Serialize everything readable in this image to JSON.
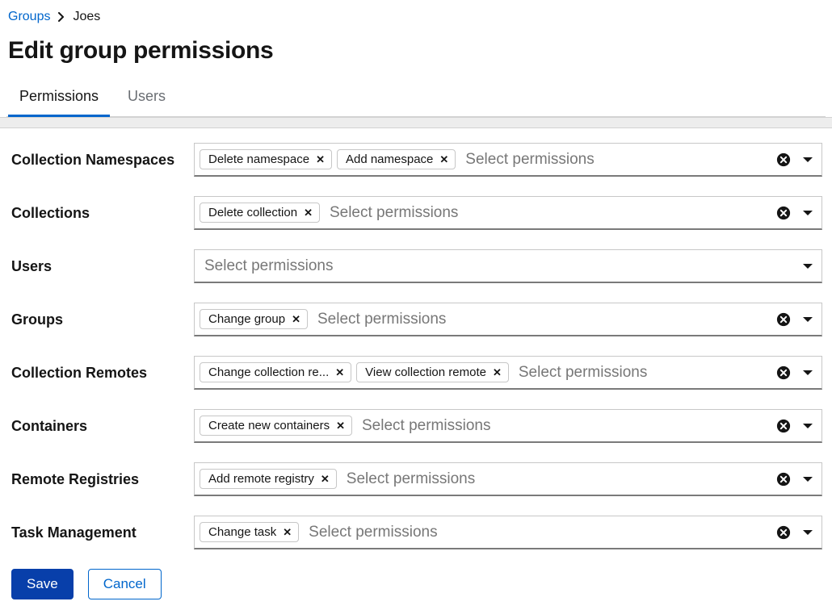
{
  "breadcrumb": {
    "root": "Groups",
    "current": "Joes"
  },
  "page_title": "Edit group permissions",
  "tabs": {
    "permissions": "Permissions",
    "users": "Users"
  },
  "placeholder": "Select permissions",
  "rows": {
    "collection_namespaces": {
      "label": "Collection Namespaces",
      "chips": [
        "Delete namespace",
        "Add namespace"
      ]
    },
    "collections": {
      "label": "Collections",
      "chips": [
        "Delete collection"
      ]
    },
    "users": {
      "label": "Users",
      "chips": []
    },
    "groups": {
      "label": "Groups",
      "chips": [
        "Change group"
      ]
    },
    "collection_remotes": {
      "label": "Collection Remotes",
      "chips": [
        "Change collection re...",
        "View collection remote"
      ]
    },
    "containers": {
      "label": "Containers",
      "chips": [
        "Create new containers"
      ]
    },
    "remote_registries": {
      "label": "Remote Registries",
      "chips": [
        "Add remote registry"
      ]
    },
    "task_management": {
      "label": "Task Management",
      "chips": [
        "Change task"
      ]
    }
  },
  "buttons": {
    "save": "Save",
    "cancel": "Cancel"
  }
}
